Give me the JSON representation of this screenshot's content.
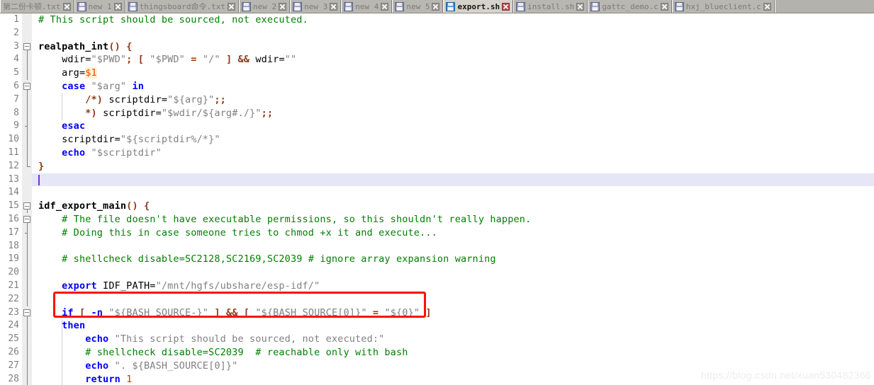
{
  "window": {
    "app": "Notepad++",
    "active_file": "export.sh"
  },
  "tabbar": {
    "tabs": [
      {
        "label": "第二份卡顿.txt",
        "active": false,
        "has_icon": false,
        "icon": "floppy-disk-icon",
        "close": "close-icon"
      },
      {
        "label": "new 1",
        "active": false,
        "has_icon": true,
        "icon": "floppy-disk-icon",
        "close": "close-icon"
      },
      {
        "label": "thingsboard命令.txt",
        "active": false,
        "has_icon": true,
        "icon": "floppy-disk-icon",
        "close": "close-icon"
      },
      {
        "label": "new 2",
        "active": false,
        "has_icon": true,
        "icon": "floppy-disk-icon",
        "close": "close-icon"
      },
      {
        "label": "new 3",
        "active": false,
        "has_icon": true,
        "icon": "floppy-disk-icon",
        "close": "close-icon"
      },
      {
        "label": "new 4",
        "active": false,
        "has_icon": true,
        "icon": "floppy-disk-icon",
        "close": "close-icon"
      },
      {
        "label": "new 5",
        "active": false,
        "has_icon": true,
        "icon": "floppy-disk-icon",
        "close": "close-icon"
      },
      {
        "label": "export.sh",
        "active": true,
        "has_icon": true,
        "icon": "floppy-disk-icon",
        "close": "close-icon"
      },
      {
        "label": "install.sh",
        "active": false,
        "has_icon": true,
        "icon": "floppy-disk-icon",
        "close": "close-icon"
      },
      {
        "label": "gattc_demo.c",
        "active": false,
        "has_icon": true,
        "icon": "floppy-disk-icon",
        "close": "close-icon"
      },
      {
        "label": "hxj_blueclient.c",
        "active": false,
        "has_icon": true,
        "icon": "floppy-disk-icon",
        "close": "close-icon"
      }
    ]
  },
  "editor": {
    "current_line": 13,
    "lines": [
      {
        "n": 1,
        "fold": "none",
        "tokens": [
          {
            "c": "t-comment",
            "t": "# This script should be sourced, not executed."
          }
        ]
      },
      {
        "n": 2,
        "fold": "none",
        "tokens": []
      },
      {
        "n": 3,
        "fold": "open",
        "tokens": [
          {
            "c": "t-fn",
            "t": "realpath_int"
          },
          {
            "c": "t-op",
            "t": "()"
          },
          {
            "c": "t-plain",
            "t": " "
          },
          {
            "c": "t-op",
            "t": "{"
          }
        ]
      },
      {
        "n": 4,
        "fold": "line",
        "tokens": [
          {
            "c": "t-plain",
            "t": "    wdir="
          },
          {
            "c": "t-str",
            "t": "\"$PWD\""
          },
          {
            "c": "t-op",
            "t": ";"
          },
          {
            "c": "t-plain",
            "t": " "
          },
          {
            "c": "t-op",
            "t": "["
          },
          {
            "c": "t-plain",
            "t": " "
          },
          {
            "c": "t-str",
            "t": "\"$PWD\""
          },
          {
            "c": "t-plain",
            "t": " "
          },
          {
            "c": "t-op",
            "t": "="
          },
          {
            "c": "t-plain",
            "t": " "
          },
          {
            "c": "t-str",
            "t": "\"/\""
          },
          {
            "c": "t-plain",
            "t": " "
          },
          {
            "c": "t-op",
            "t": "]"
          },
          {
            "c": "t-plain",
            "t": " "
          },
          {
            "c": "t-op",
            "t": "&&"
          },
          {
            "c": "t-plain",
            "t": " wdir="
          },
          {
            "c": "t-str",
            "t": "\"\""
          }
        ]
      },
      {
        "n": 5,
        "fold": "line",
        "tokens": [
          {
            "c": "t-plain",
            "t": "    arg="
          },
          {
            "c": "t-var",
            "t": "$1"
          }
        ]
      },
      {
        "n": 6,
        "fold": "open2",
        "tokens": [
          {
            "c": "t-kw",
            "t": "    case"
          },
          {
            "c": "t-plain",
            "t": " "
          },
          {
            "c": "t-str",
            "t": "\"$arg\""
          },
          {
            "c": "t-plain",
            "t": " "
          },
          {
            "c": "t-kw",
            "t": "in"
          }
        ]
      },
      {
        "n": 7,
        "fold": "line",
        "tokens": [
          {
            "c": "t-plain",
            "t": "        "
          },
          {
            "c": "t-op",
            "t": "/*)"
          },
          {
            "c": "t-plain",
            "t": " scriptdir="
          },
          {
            "c": "t-str",
            "t": "\"${arg}\""
          },
          {
            "c": "t-op",
            "t": ";;"
          }
        ]
      },
      {
        "n": 8,
        "fold": "line",
        "tokens": [
          {
            "c": "t-plain",
            "t": "        "
          },
          {
            "c": "t-op",
            "t": "*)"
          },
          {
            "c": "t-plain",
            "t": " scriptdir="
          },
          {
            "c": "t-str",
            "t": "\"$wdir/${arg#./}\""
          },
          {
            "c": "t-op",
            "t": ";;"
          }
        ]
      },
      {
        "n": 9,
        "fold": "endmid",
        "tokens": [
          {
            "c": "t-kw",
            "t": "    esac"
          }
        ]
      },
      {
        "n": 10,
        "fold": "line",
        "tokens": [
          {
            "c": "t-plain",
            "t": "    scriptdir="
          },
          {
            "c": "t-str",
            "t": "\"${scriptdir%/*}\""
          }
        ]
      },
      {
        "n": 11,
        "fold": "line",
        "tokens": [
          {
            "c": "t-kw",
            "t": "    echo"
          },
          {
            "c": "t-plain",
            "t": " "
          },
          {
            "c": "t-str",
            "t": "\"$scriptdir\""
          }
        ]
      },
      {
        "n": 12,
        "fold": "end",
        "tokens": [
          {
            "c": "t-op",
            "t": "}"
          }
        ]
      },
      {
        "n": 13,
        "fold": "none",
        "tokens": []
      },
      {
        "n": 14,
        "fold": "none",
        "tokens": []
      },
      {
        "n": 15,
        "fold": "open",
        "tokens": [
          {
            "c": "t-fn",
            "t": "idf_export_main"
          },
          {
            "c": "t-op",
            "t": "()"
          },
          {
            "c": "t-plain",
            "t": " "
          },
          {
            "c": "t-op",
            "t": "{"
          }
        ]
      },
      {
        "n": 16,
        "fold": "open2",
        "tokens": [
          {
            "c": "t-comment",
            "t": "    # The file doesn't have executable permissions, so this shouldn't really happen."
          }
        ]
      },
      {
        "n": 17,
        "fold": "endmid",
        "tokens": [
          {
            "c": "t-comment",
            "t": "    # Doing this in case someone tries to chmod +x it and execute..."
          }
        ]
      },
      {
        "n": 18,
        "fold": "line",
        "tokens": []
      },
      {
        "n": 19,
        "fold": "line",
        "tokens": [
          {
            "c": "t-comment",
            "t": "    # shellcheck disable=SC2128,SC2169,SC2039 # ignore array expansion warning"
          }
        ]
      },
      {
        "n": 20,
        "fold": "line",
        "tokens": []
      },
      {
        "n": 21,
        "fold": "line",
        "tokens": [
          {
            "c": "t-kw",
            "t": "    export"
          },
          {
            "c": "t-plain",
            "t": " IDF_PATH="
          },
          {
            "c": "t-str",
            "t": "\"/mnt/hgfs/ubshare/esp-idf/\""
          }
        ]
      },
      {
        "n": 22,
        "fold": "line",
        "tokens": []
      },
      {
        "n": 23,
        "fold": "open2",
        "tokens": [
          {
            "c": "t-kw",
            "t": "    if"
          },
          {
            "c": "t-plain",
            "t": " "
          },
          {
            "c": "t-op",
            "t": "["
          },
          {
            "c": "t-plain",
            "t": " "
          },
          {
            "c": "t-kw",
            "t": "-n"
          },
          {
            "c": "t-plain",
            "t": " "
          },
          {
            "c": "t-str",
            "t": "\"${BASH_SOURCE-}\""
          },
          {
            "c": "t-plain",
            "t": " "
          },
          {
            "c": "t-op",
            "t": "]"
          },
          {
            "c": "t-plain",
            "t": " "
          },
          {
            "c": "t-op",
            "t": "&&"
          },
          {
            "c": "t-plain",
            "t": " "
          },
          {
            "c": "t-op",
            "t": "["
          },
          {
            "c": "t-plain",
            "t": " "
          },
          {
            "c": "t-str",
            "t": "\"${BASH_SOURCE[0]}\""
          },
          {
            "c": "t-plain",
            "t": " "
          },
          {
            "c": "t-op",
            "t": "="
          },
          {
            "c": "t-plain",
            "t": " "
          },
          {
            "c": "t-str",
            "t": "\"${0}\""
          },
          {
            "c": "t-plain",
            "t": " "
          },
          {
            "c": "t-op",
            "t": "]"
          }
        ]
      },
      {
        "n": 24,
        "fold": "line",
        "tokens": [
          {
            "c": "t-kw",
            "t": "    then"
          }
        ]
      },
      {
        "n": 25,
        "fold": "line",
        "tokens": [
          {
            "c": "t-kw",
            "t": "        echo"
          },
          {
            "c": "t-plain",
            "t": " "
          },
          {
            "c": "t-str",
            "t": "\"This script should be sourced, not executed:\""
          }
        ]
      },
      {
        "n": 26,
        "fold": "line",
        "tokens": [
          {
            "c": "t-comment",
            "t": "        # shellcheck disable=SC2039  # reachable only with bash"
          }
        ]
      },
      {
        "n": 27,
        "fold": "line",
        "tokens": [
          {
            "c": "t-kw",
            "t": "        echo"
          },
          {
            "c": "t-plain",
            "t": " "
          },
          {
            "c": "t-str",
            "t": "\". ${BASH_SOURCE[0]}\""
          }
        ]
      },
      {
        "n": 28,
        "fold": "line",
        "tokens": [
          {
            "c": "t-kw",
            "t": "        return"
          },
          {
            "c": "t-plain",
            "t": " "
          },
          {
            "c": "t-num",
            "t": "1"
          }
        ]
      }
    ]
  },
  "annotation": {
    "highlight_box_line": 21,
    "highlight_box_color": "#fc1005"
  },
  "watermark": {
    "text": "https://blog.csdn.net/xuan530482366"
  }
}
